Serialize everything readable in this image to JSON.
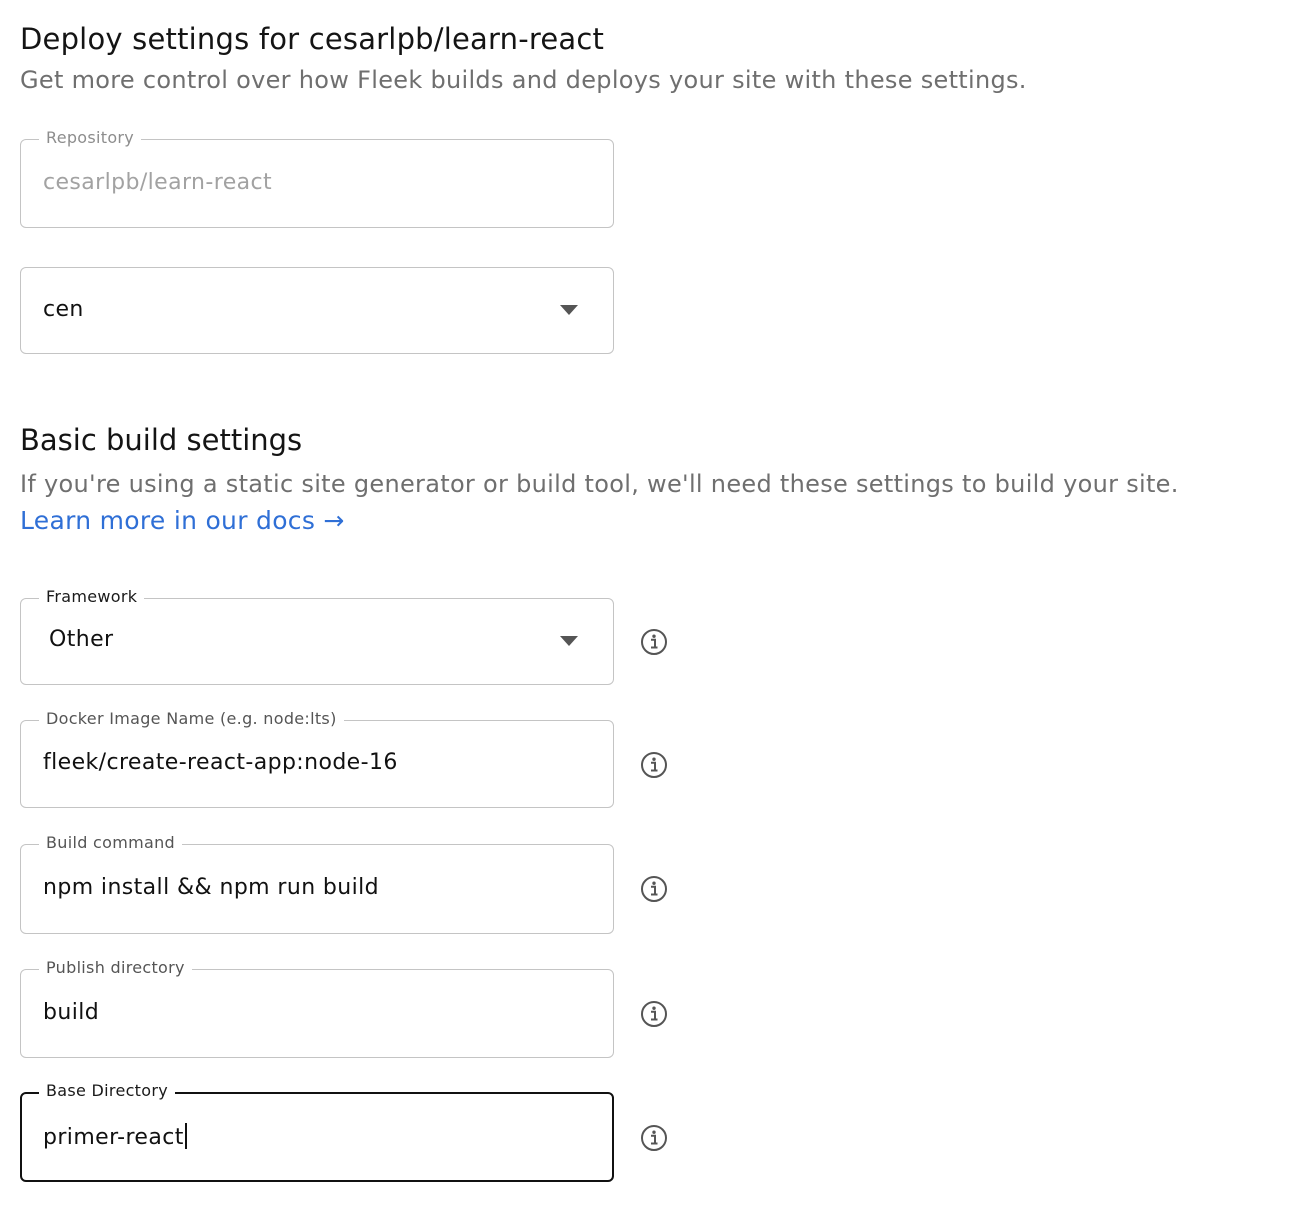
{
  "header": {
    "title": "Deploy settings for cesarlpb/learn-react",
    "subtitle": "Get more control over how Fleek builds and deploys your site with these settings."
  },
  "repository": {
    "label": "Repository",
    "value": "cesarlpb/learn-react"
  },
  "branch": {
    "value": "cen"
  },
  "build": {
    "title": "Basic build settings",
    "description": "If you're using a static site generator or build tool, we'll need these settings to build your site.",
    "docs_link": "Learn more in our docs →"
  },
  "framework": {
    "label": "Framework",
    "value": "Other"
  },
  "docker_image": {
    "label": "Docker Image Name (e.g. node:lts)",
    "value": "fleek/create-react-app:node-16"
  },
  "build_command": {
    "label": "Build command",
    "value": "npm install && npm run build"
  },
  "publish_directory": {
    "label": "Publish directory",
    "value": "build"
  },
  "base_directory": {
    "label": "Base Directory",
    "value": "primer-react"
  },
  "icons": {
    "dropdown": "chevron-down-icon",
    "info": "info-icon"
  },
  "colors": {
    "link": "#2f6fd6",
    "border": "#c4c4c4",
    "focused_border": "#111111",
    "muted_text": "#6f6f6f"
  }
}
